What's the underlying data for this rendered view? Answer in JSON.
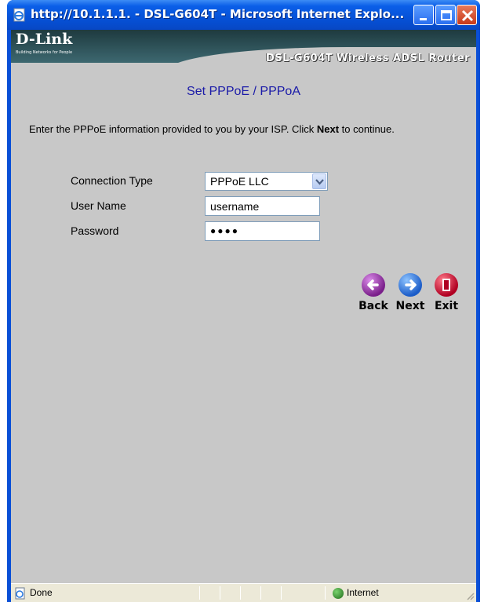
{
  "window": {
    "title": "http://10.1.1.1. - DSL-G604T - Microsoft Internet Explo..."
  },
  "banner": {
    "logo": "D-Link",
    "tagline": "Building Networks for People",
    "product": "DSL-G604T Wireless ADSL Router"
  },
  "page": {
    "title": "Set PPPoE / PPPoA",
    "instructions_before": "Enter the PPPoE information provided to you by your ISP. Click ",
    "instructions_bold": "Next",
    "instructions_after": " to continue."
  },
  "form": {
    "connection_type_label": "Connection Type",
    "connection_type_value": "PPPoE LLC",
    "username_label": "User Name",
    "username_value": "username",
    "password_label": "Password",
    "password_value": "●●●●"
  },
  "nav": {
    "back_label": "Back",
    "next_label": "Next",
    "exit_label": "Exit"
  },
  "statusbar": {
    "status": "Done",
    "zone": "Internet"
  }
}
